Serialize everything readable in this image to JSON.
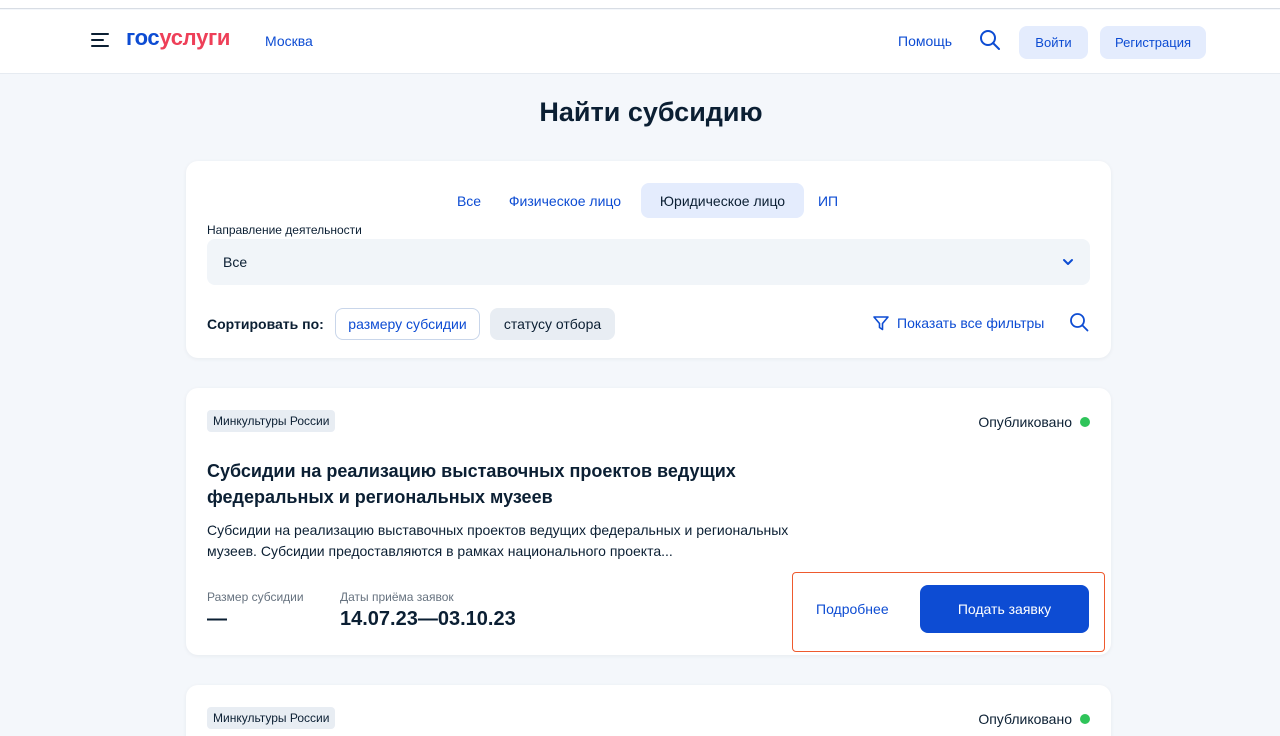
{
  "header": {
    "logo_part1": "гос",
    "logo_part2": "услуги",
    "city": "Москва",
    "help": "Помощь",
    "login": "Войти",
    "register": "Регистрация"
  },
  "page": {
    "title": "Найти субсидию"
  },
  "filters": {
    "tabs": [
      {
        "label": "Все",
        "active": false
      },
      {
        "label": "Физическое лицо",
        "active": false
      },
      {
        "label": "Юридическое лицо",
        "active": true
      },
      {
        "label": "ИП",
        "active": false
      }
    ],
    "direction_label": "Направление деятельности",
    "direction_value": "Все",
    "sort_label": "Сортировать по:",
    "sort_options": [
      "размеру субсидии",
      "статусу отбора"
    ],
    "show_all_filters": "Показать все фильтры"
  },
  "subsidies": [
    {
      "agency": "Минкультуры России",
      "status": "Опубликовано",
      "title": "Субсидии на реализацию выставочных проектов ведущих федеральных и региональных музеев",
      "description": "Субсидии на реализацию выставочных проектов ведущих федеральных и региональных музеев. Субсидии предоставляются в рамках национального проекта...",
      "amount_label": "Размер субсидии",
      "amount_value": "—",
      "dates_label": "Даты приёма заявок",
      "dates_value": "14.07.23—03.10.23",
      "more_label": "Подробнее",
      "apply_label": "Подать заявку"
    },
    {
      "agency": "Минкультуры России",
      "status": "Опубликовано"
    }
  ],
  "colors": {
    "brand_blue": "#0d4cd3",
    "brand_red": "#ee3f58",
    "status_green": "#2fc45a",
    "highlight_orange": "#ee5a2e"
  }
}
